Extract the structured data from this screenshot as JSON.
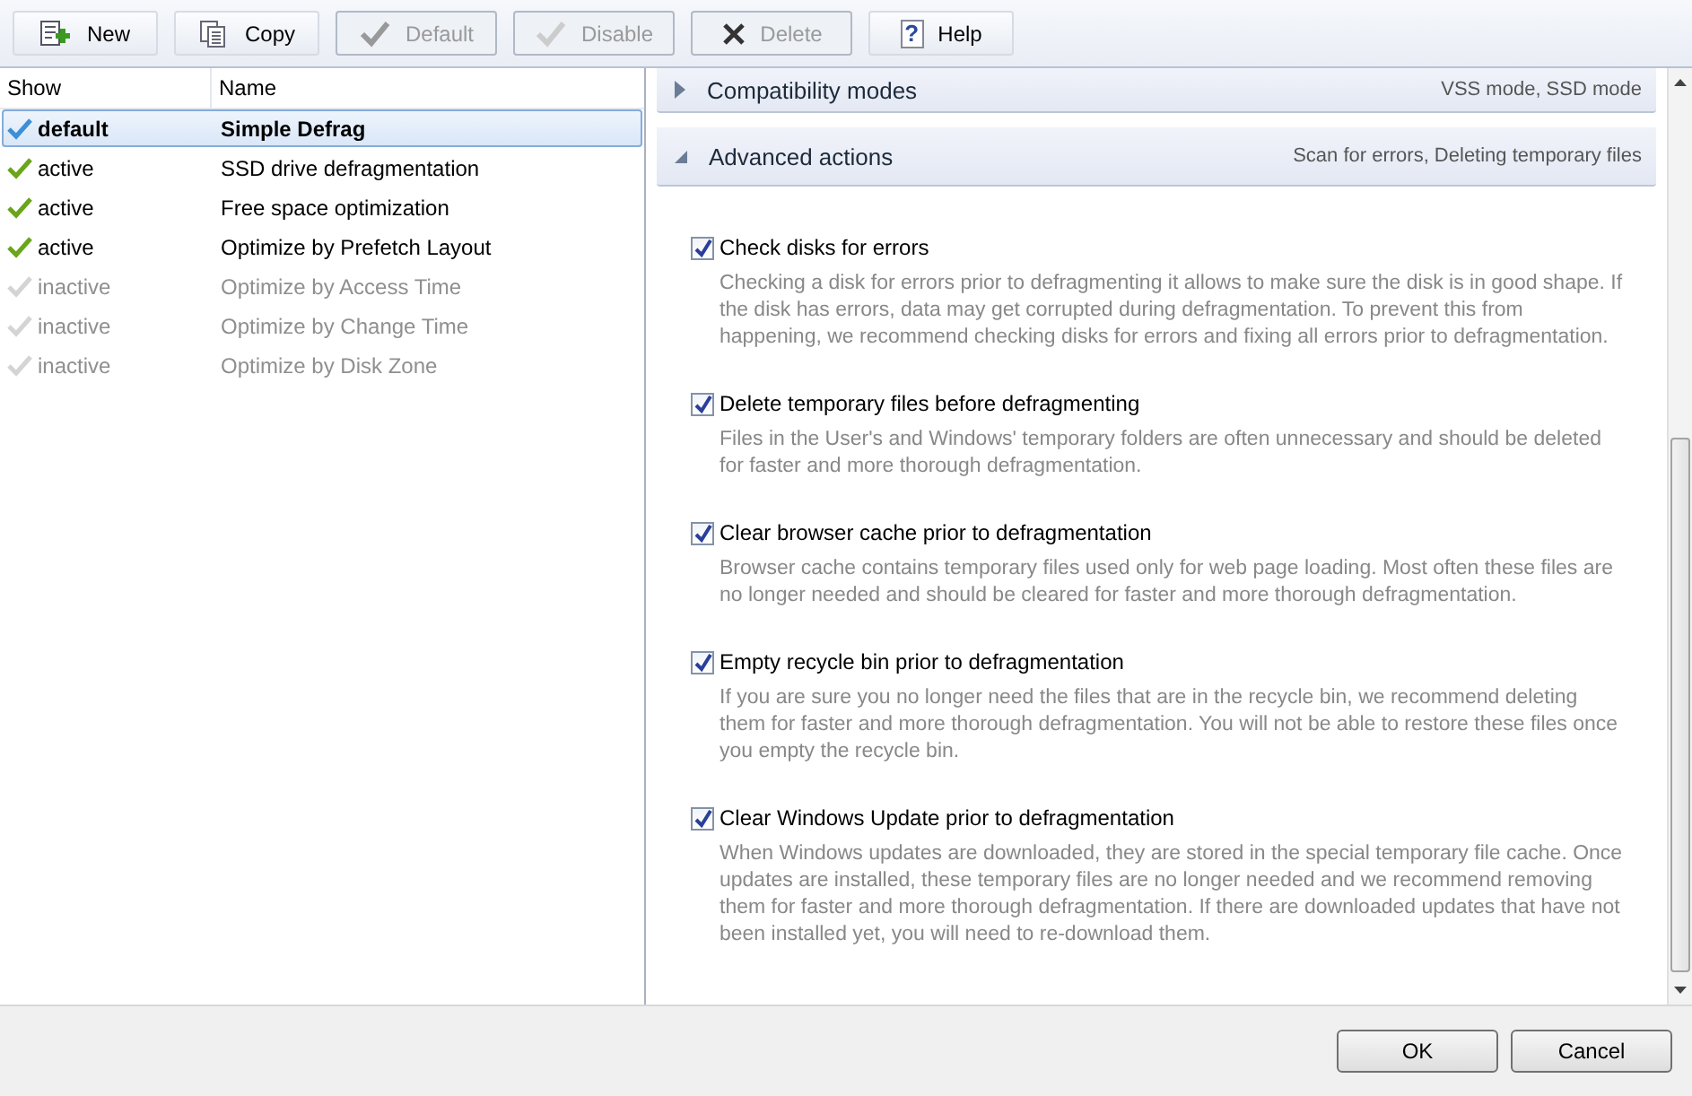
{
  "toolbar": [
    {
      "label": "New",
      "kind": "new",
      "disabled": false
    },
    {
      "label": "Copy",
      "kind": "copy",
      "disabled": false
    },
    {
      "label": "Default",
      "kind": "check",
      "disabled": true
    },
    {
      "label": "Disable",
      "kind": "outline",
      "disabled": true
    },
    {
      "label": "Delete",
      "kind": "cross",
      "disabled": true
    },
    {
      "label": "Help",
      "kind": "help",
      "glyph": "?",
      "disabled": false
    }
  ],
  "profiles": {
    "columns": [
      "Show",
      "Name"
    ],
    "rows": [
      {
        "status": "default",
        "name": "Simple Defrag",
        "kind": "default",
        "selected": true
      },
      {
        "status": "active",
        "name": "SSD drive defragmentation",
        "kind": "active",
        "selected": false
      },
      {
        "status": "active",
        "name": "Free space optimization",
        "kind": "active",
        "selected": false
      },
      {
        "status": "active",
        "name": "Optimize by Prefetch Layout",
        "kind": "active",
        "selected": false
      },
      {
        "status": "inactive",
        "name": "Optimize by Access Time",
        "kind": "inactive",
        "selected": false
      },
      {
        "status": "inactive",
        "name": "Optimize by Change Time",
        "kind": "inactive",
        "selected": false
      },
      {
        "status": "inactive",
        "name": "Optimize by Disk Zone",
        "kind": "inactive",
        "selected": false
      }
    ]
  },
  "sections": [
    {
      "title": "Compatibility modes",
      "summary": "VSS mode, SSD mode",
      "expanded": false
    },
    {
      "title": "Advanced actions",
      "summary": "Scan for errors, Deleting temporary files",
      "expanded": true,
      "options": [
        {
          "label": "Check disks for errors",
          "checked": true,
          "description": "Checking a disk for errors prior to defragmenting it allows to make sure the disk is in good shape. If the disk has errors, data may get corrupted during defragmentation. To prevent this from happening, we recommend checking disks for errors and fixing all errors prior to defragmentation."
        },
        {
          "label": "Delete temporary files before defragmenting",
          "checked": true,
          "description": "Files in the User's and Windows' temporary folders are often unnecessary and should be deleted for faster and more thorough defragmentation."
        },
        {
          "label": "Clear browser cache prior to defragmentation",
          "checked": true,
          "description": "Browser cache contains temporary files used only for web page loading. Most often these files are no longer needed and should be cleared for faster and more thorough defragmentation."
        },
        {
          "label": "Empty recycle bin prior to defragmentation",
          "checked": true,
          "description": "If you are sure you no longer need the files that are in the recycle bin, we recommend deleting them for faster and more thorough defragmentation. You will not be able to restore these files once you empty the recycle bin."
        },
        {
          "label": "Clear Windows Update prior to defragmentation",
          "checked": true,
          "description": "When Windows updates are downloaded, they are stored in the special temporary file cache. Once updates are installed, these temporary files are no longer needed and we recommend removing them for faster and more thorough defragmentation. If there are downloaded updates that have not been installed yet, you will need to re-download them."
        }
      ]
    }
  ],
  "footer": {
    "buttons": [
      "OK",
      "Cancel"
    ]
  }
}
